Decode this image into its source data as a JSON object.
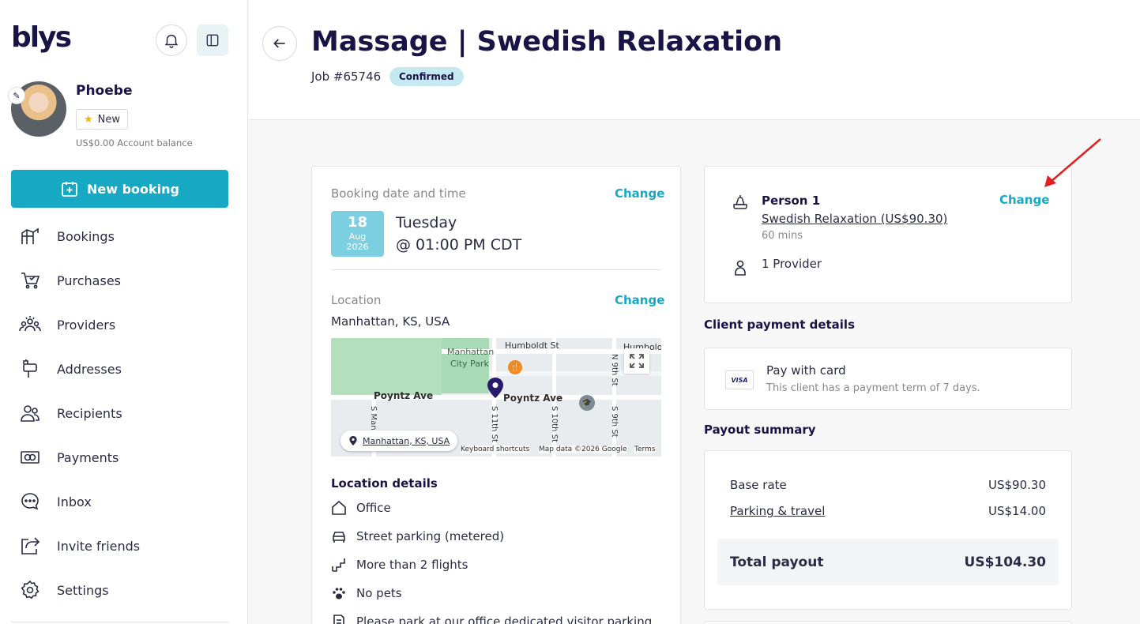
{
  "sidebar": {
    "logo": "blys",
    "user": {
      "name": "Phoebe",
      "badge": "New",
      "balance_amount": "US$0.00",
      "balance_label": "Account balance"
    },
    "new_booking_label": "New booking",
    "items": [
      {
        "label": "Bookings",
        "icon": "bookings-icon"
      },
      {
        "label": "Purchases",
        "icon": "cart-icon"
      },
      {
        "label": "Providers",
        "icon": "providers-icon"
      },
      {
        "label": "Addresses",
        "icon": "mailbox-icon"
      },
      {
        "label": "Recipients",
        "icon": "recipients-icon"
      },
      {
        "label": "Payments",
        "icon": "payments-icon"
      },
      {
        "label": "Inbox",
        "icon": "chat-icon"
      },
      {
        "label": "Invite friends",
        "icon": "share-icon"
      },
      {
        "label": "Settings",
        "icon": "gear-icon"
      }
    ]
  },
  "header": {
    "title": "Massage | Swedish Relaxation",
    "job_number": "Job #65746",
    "status": "Confirmed"
  },
  "booking": {
    "date_label": "Booking date and time",
    "change_label": "Change",
    "day": "18",
    "month": "Aug",
    "year": "2026",
    "weekday": "Tuesday",
    "time": "@ 01:00 PM CDT",
    "location_label": "Location",
    "address": "Manhattan, KS, USA",
    "map": {
      "park_name_1": "Manhattan",
      "park_name_2": "City Park",
      "street_humboldt": "Humboldt St",
      "street_humboldt_2": "Humbolo",
      "street_poyntz_1": "Poyntz Ave",
      "street_poyntz_2": "Poyntz Ave",
      "street_s11": "S 11th St",
      "street_s10": "S 10th St",
      "street_s9": "S 9th St",
      "street_s9_top": "N 9th St",
      "street_sman": "S Man",
      "chip_label": "Manhattan, KS, USA",
      "attr_shortcuts": "Keyboard shortcuts",
      "attr_data": "Map data ©2026 Google",
      "attr_terms": "Terms"
    },
    "details_title": "Location details",
    "details": [
      "Office",
      "Street parking (metered)",
      "More than 2 flights",
      "No pets",
      "Please park at our office dedicated visitor parking"
    ]
  },
  "person": {
    "title": "Person 1",
    "service": "Swedish Relaxation (US$90.30)",
    "duration": "60 mins",
    "providers": "1 Provider",
    "change_label": "Change"
  },
  "client_payment": {
    "title": "Client payment details",
    "card_brand": "VISA",
    "method": "Pay with card",
    "terms": "This client has a payment term of 7 days."
  },
  "payout": {
    "title": "Payout summary",
    "base_label": "Base rate",
    "base_value": "US$90.30",
    "travel_label": "Parking & travel",
    "travel_value": "US$14.00",
    "total_label": "Total payout",
    "total_value": "US$104.30"
  },
  "colors": {
    "brand": "#1a1446",
    "accent": "#17a9c4",
    "annotation_arrow": "#e02020"
  }
}
